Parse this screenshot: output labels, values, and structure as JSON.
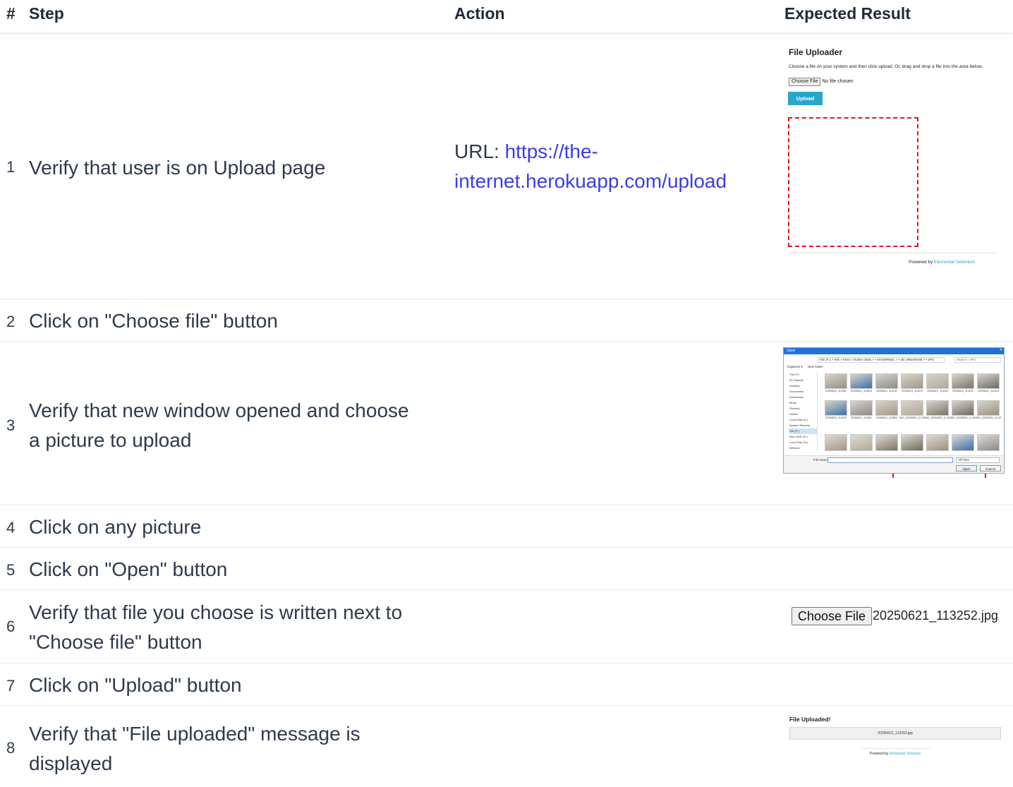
{
  "header": {
    "num": "#",
    "step": "Step",
    "action": "Action",
    "expected": "Expected Result"
  },
  "rows": [
    {
      "num": "1",
      "step": "Verify that user is on Upload page",
      "action_prefix": "URL: ",
      "action_link_1": "https://the-",
      "action_link_2": "internet.herokuapp.com/upload"
    },
    {
      "num": "2",
      "step": "Click on \"Choose file\" button"
    },
    {
      "num": "3",
      "step_1": "Verify that new window opened and choose",
      "step_2": "a picture to upload"
    },
    {
      "num": "4",
      "step": "Click on any picture"
    },
    {
      "num": "5",
      "step": "Click on \"Open\" button"
    },
    {
      "num": "6",
      "step_1": "Verify that file you choose is written next to",
      "step_2": "\"Choose file\" button"
    },
    {
      "num": "7",
      "step": "Click on \"Upload\" button"
    },
    {
      "num": "8",
      "step_1": "Verify that \"File uploaded\" message is",
      "step_2": "displayed"
    }
  ],
  "uploader_shot": {
    "title": "File Uploader",
    "description": "Choose a file on your system and then click upload. Or, drag and drop a file into the area below.",
    "choose_label": "Choose File",
    "no_file": "No file chosen",
    "upload_label": "Upload",
    "powered_prefix": "Powered by ",
    "powered_link": "Elemental Selenium"
  },
  "dialog_shot": {
    "title": "Open",
    "address": "Kiki (F:)  >  Kiki  >  KIKIA / DUBAI 2025  >  • SHOWREEL  >  • 3D URBANISM  >  • JPG",
    "search_placeholder": "Search • JPG",
    "organize": "Organize ▾",
    "new_folder": "New folder",
    "tree": [
      "This PC",
      "3D Objects",
      "Desktop",
      "Documents",
      "Downloads",
      "Music",
      "Pictures",
      "Videos",
      "Local Disk (C:)",
      "System Reserve",
      "Kiki (F:)",
      "Novi HDD (G:)",
      "Local Disk (H:)",
      "Network"
    ],
    "row1_captions": [
      "20250621_113252",
      "20250621_113518",
      "20250621_114132",
      "20250621_114215",
      "20250621_114226",
      "20250621_114231",
      "20250621_114416"
    ],
    "row2_captions": [
      "20250621_114423",
      "20250621_114602",
      "20250621_115553",
      "IMG_20250621_11 2307",
      "IMG_20250621_11 3624",
      "IMG_20250621_11 4049",
      "IMG_20250621_11 4251"
    ],
    "file_name_label": "File name:",
    "filter": "All Files",
    "open_label": "Open",
    "cancel_label": "Cancel"
  },
  "chosen_shot": {
    "choose_label": "Choose File",
    "file_name": "20250621_113252.jpg"
  },
  "uploaded_shot": {
    "title": "File Uploaded!",
    "file_name": "20250621_113252.jpg",
    "powered_prefix": "Powered by ",
    "powered_link": "Elemental Selenium"
  }
}
